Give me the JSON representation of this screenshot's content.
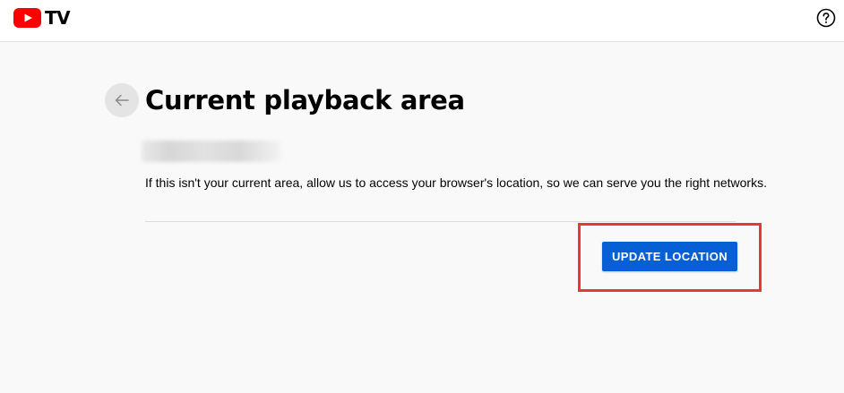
{
  "header": {
    "logo_text": "TV",
    "logo_icon": "youtube-play-logo",
    "help_icon": "question-circle-icon"
  },
  "main": {
    "back_icon": "arrow-left-icon",
    "title": "Current playback area",
    "location_redacted": "",
    "info_text": "If this isn't your current area, allow us to access your browser's location, so we can serve you the right networks.",
    "update_button_label": "UPDATE LOCATION"
  },
  "colors": {
    "brand_red": "#ff0000",
    "button_blue": "#065fd4",
    "highlight_red": "#e53935",
    "background": "#f9f9f9"
  }
}
